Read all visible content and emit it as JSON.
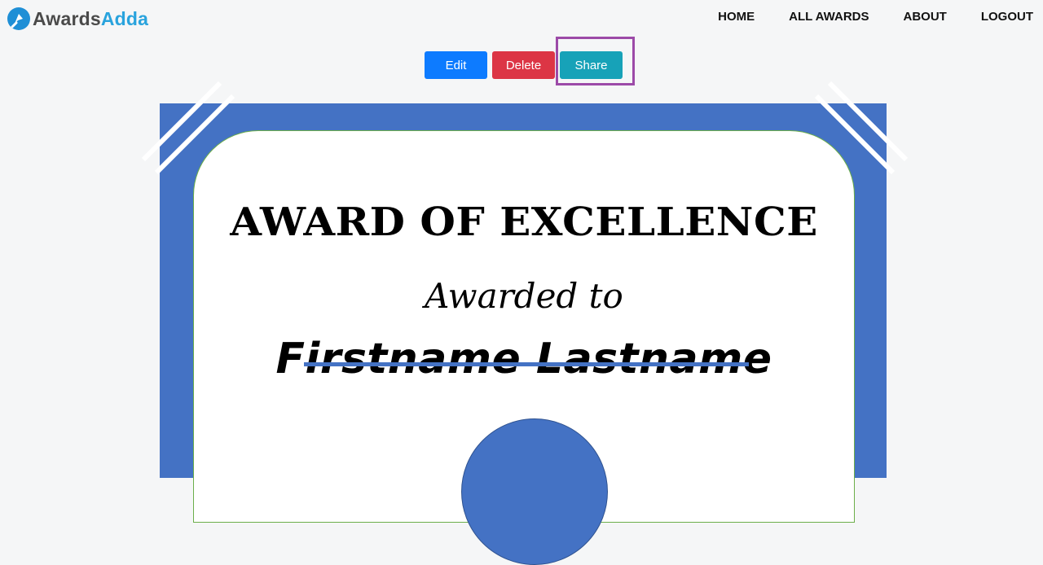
{
  "brand": {
    "name_part1": "Awards",
    "name_part2": "Adda"
  },
  "nav": [
    {
      "label": "HOME"
    },
    {
      "label": "ALL AWARDS"
    },
    {
      "label": "ABOUT"
    },
    {
      "label": "LOGOUT"
    }
  ],
  "actions": {
    "edit_label": "Edit",
    "delete_label": "Delete",
    "share_label": "Share"
  },
  "certificate": {
    "title": "AWARD OF EXCELLENCE",
    "awarded_text": "Awarded to",
    "recipient_name": "Firstname Lastname"
  },
  "colors": {
    "page_bg": "#f5f6f7",
    "certificate_blue": "#4472c4",
    "edit": "#0d7bff",
    "delete": "#dc3545",
    "share": "#17a2b8",
    "highlight": "#9c4aa8"
  }
}
